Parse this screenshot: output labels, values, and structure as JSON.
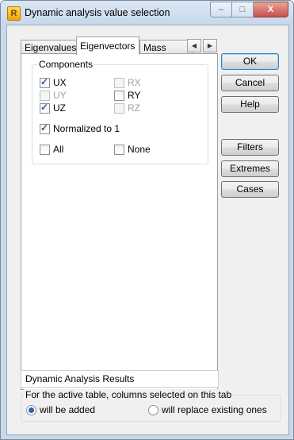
{
  "window": {
    "title": "Dynamic analysis value selection",
    "app_icon_letter": "R"
  },
  "caption_buttons": {
    "minimize": "–",
    "maximize": "□",
    "close": "X"
  },
  "tabs": [
    {
      "label": "Eigenvalues",
      "active": false
    },
    {
      "label": "Eigenvectors",
      "active": true
    },
    {
      "label": "Mass sums",
      "active": false
    }
  ],
  "tab_arrows": {
    "left": "◀",
    "right": "▶"
  },
  "components": {
    "label": "Components",
    "items": [
      {
        "label": "UX",
        "checked": true,
        "enabled": true
      },
      {
        "label": "RX",
        "checked": false,
        "enabled": false
      },
      {
        "label": "UY",
        "checked": false,
        "enabled": false
      },
      {
        "label": "RY",
        "checked": false,
        "enabled": true
      },
      {
        "label": "UZ",
        "checked": true,
        "enabled": true
      },
      {
        "label": "RZ",
        "checked": false,
        "enabled": false
      }
    ],
    "normalized": {
      "label": "Normalized to 1",
      "checked": true
    },
    "all": {
      "label": "All",
      "checked": false
    },
    "none": {
      "label": "None",
      "checked": false
    }
  },
  "buttons": {
    "ok": "OK",
    "cancel": "Cancel",
    "help": "Help",
    "filters": "Filters",
    "extremes": "Extremes",
    "cases": "Cases"
  },
  "result_field": {
    "value": "Dynamic Analysis Results"
  },
  "options": {
    "label": "For the active table, columns selected on this tab",
    "will_be_added": {
      "label": "will be added",
      "selected": true
    },
    "will_replace": {
      "label": "will replace existing ones",
      "selected": false
    }
  }
}
